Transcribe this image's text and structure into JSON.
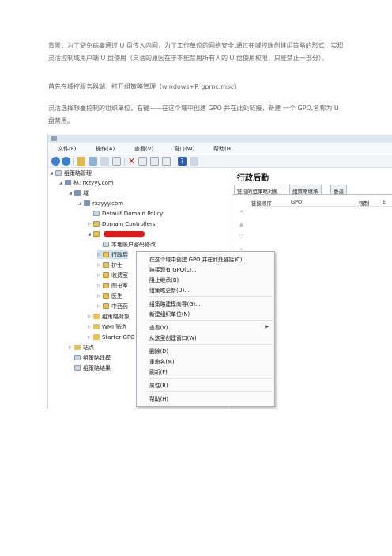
{
  "doc": {
    "para1": "背景：为了避免病毒通过 U 盘传入内网，为了工作单位的网络安全,通过在域控端创建组策略的形式，实现灵活控制域用户端 U 盘使用（灵活的原因在于不能禁用所有人的 U 盘使用权限，只能禁止一部分）。",
    "para2": "首先在域控服务器端，打开组策略管理（windows+R gpmc.msc）",
    "para3": "灵活选择想要控制的组织单位，右键——在这个域中创建 GPO 并在此处链接，新建 一个 GPO,名称为 U 盘禁用。"
  },
  "screenshot": {
    "menu": [
      "文件(F)",
      "操作(A)",
      "查看(V)",
      "窗口(W)",
      "帮助(H)"
    ],
    "tree": {
      "root": "组策略管理",
      "forest": "林: rxzyyy.com",
      "domains": "域",
      "domain": "rxzyyy.com",
      "items": [
        "Default Domain Policy",
        "Domain Controllers"
      ],
      "local_policy": "本地账户密码修改",
      "ous": [
        "行政后",
        "护士",
        "收费室",
        "图书室",
        "医生",
        "中西药"
      ],
      "after": [
        "组策略对象",
        "WMI 筛选",
        "Starter GPO"
      ],
      "sites": "站点",
      "modeling": "组策略建模",
      "results": "组策略结果"
    },
    "right_panel": {
      "title": "行政后勤",
      "tabs": [
        "链接的组策略对象",
        "组策略继承",
        "委派"
      ],
      "columns": [
        "链接顺序",
        "GPO",
        "强制",
        "E"
      ]
    },
    "context_menu": [
      "在这个域中创建 GPO 并在此处链接(C)...",
      "链接现有 GPO(L)...",
      "阻止继承(B)",
      "组策略更新(U)...",
      "组策略建模向导(G)...",
      "新建组织单位(N)",
      "查看(V)",
      "从这里创建窗口(W)",
      "删除(D)",
      "重命名(M)",
      "刷新(F)",
      "属性(R)",
      "帮助(H)"
    ]
  }
}
